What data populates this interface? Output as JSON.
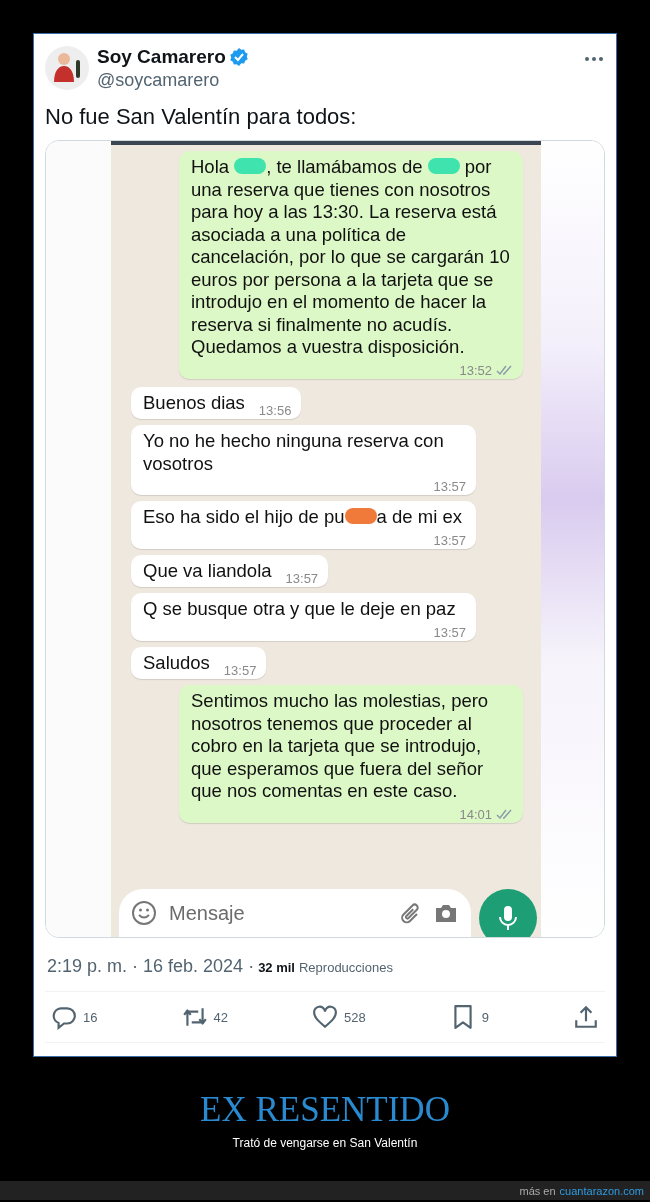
{
  "tweet": {
    "name": "Soy Camarero",
    "verified": true,
    "handle": "@soycamarero",
    "text": "No fue San Valentín para todos:",
    "chat": {
      "messages": [
        {
          "kind": "sent",
          "segments": [
            {
              "kind": "text",
              "text": "Hola "
            },
            {
              "kind": "redaction",
              "color": "#3fe3ad"
            },
            {
              "kind": "text",
              "text": ", te llamábamos de "
            },
            {
              "kind": "redaction",
              "color": "#3fe3ad"
            },
            {
              "kind": "text",
              "text": " por una reserva que tienes con nosotros para hoy a las 13:30. La reserva está asociada a una política de cancelación, por lo que se cargarán 10 euros por persona a la tarjeta que se introdujo en el momento de hacer la reserva si finalmente no acudís. Quedamos a vuestra disposición."
            }
          ],
          "time": "13:52"
        },
        {
          "kind": "received",
          "segments": [
            {
              "kind": "text",
              "text": "Buenos dias"
            }
          ],
          "time": "13:56"
        },
        {
          "kind": "received",
          "segments": [
            {
              "kind": "text",
              "text": "Yo no he hecho ninguna reserva con vosotros"
            }
          ],
          "time": "13:57"
        },
        {
          "kind": "received",
          "segments": [
            {
              "kind": "text",
              "text": "Eso ha sido el hijo de pu"
            },
            {
              "kind": "redaction",
              "color": "#f07a3a"
            },
            {
              "kind": "text",
              "text": "a de mi ex"
            }
          ],
          "time": "13:57"
        },
        {
          "kind": "received",
          "segments": [
            {
              "kind": "text",
              "text": "Que va liandola"
            }
          ],
          "time": "13:57"
        },
        {
          "kind": "received",
          "segments": [
            {
              "kind": "text",
              "text": "Q se busque otra y que le deje en paz"
            }
          ],
          "time": "13:57"
        },
        {
          "kind": "received",
          "segments": [
            {
              "kind": "text",
              "text": "Saludos"
            }
          ],
          "time": "13:57"
        },
        {
          "kind": "sent",
          "segments": [
            {
              "kind": "text",
              "text": "Sentimos mucho las molestias, pero nosotros tenemos que proceder al cobro en la tarjeta que se introdujo, que esperamos que fuera del señor que nos comentas en este caso."
            }
          ],
          "time": "14:01"
        }
      ],
      "input": {
        "placeholder": "Mensaje"
      }
    },
    "meta": {
      "date": "2:19 p. m. · 16 feb. 2024 ·",
      "views_count": "32 mil",
      "views_label": "Reproducciones"
    },
    "actions": [
      {
        "kind": "reply",
        "count": "16"
      },
      {
        "kind": "retweet",
        "count": "42"
      },
      {
        "kind": "like",
        "count": "528"
      },
      {
        "kind": "bookmark",
        "count": "9"
      },
      {
        "kind": "share"
      }
    ]
  },
  "caption": {
    "title": "EX RESENTIDO",
    "subtitle": "Trató de vengarse en San Valentín"
  },
  "footer": {
    "prefix": "más en",
    "link": "cuantarazon.com"
  }
}
